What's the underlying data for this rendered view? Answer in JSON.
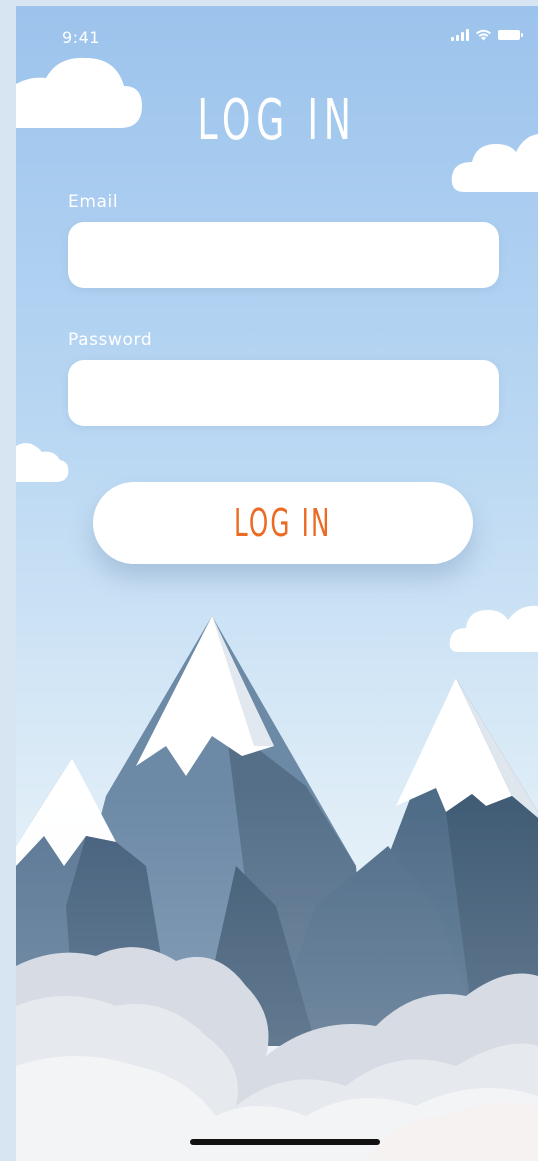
{
  "status_bar": {
    "time": "9:41",
    "icons": [
      "cellular-signal-icon",
      "wifi-icon",
      "battery-icon"
    ]
  },
  "header": {
    "title": "LOG IN"
  },
  "form": {
    "email": {
      "label": "Email",
      "value": "",
      "placeholder": ""
    },
    "password": {
      "label": "Password",
      "value": "",
      "placeholder": ""
    },
    "submit_label": "LOG IN"
  },
  "colors": {
    "sky_top": "#9cc3ec",
    "sky_bottom": "#f1f5f8",
    "accent": "#ec6b24",
    "mountain_dark": "#4a6580",
    "mountain_mid": "#6f8aa6",
    "snow": "#ffffff"
  }
}
